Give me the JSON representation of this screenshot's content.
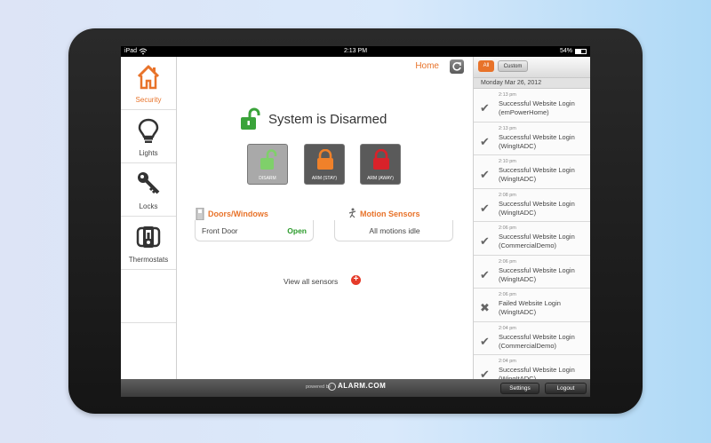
{
  "statusbar": {
    "carrier": "iPad",
    "time": "2:13 PM",
    "battery": "54%"
  },
  "nav": {
    "items": [
      {
        "label": "Security",
        "icon": "home-icon",
        "active": true
      },
      {
        "label": "Lights",
        "icon": "lightbulb-icon"
      },
      {
        "label": "Locks",
        "icon": "key-icon"
      },
      {
        "label": "Thermostats",
        "icon": "thermostat-icon"
      }
    ]
  },
  "main": {
    "home_link": "Home",
    "system_status": "System is Disarmed",
    "arm_buttons": [
      {
        "label": "DISARM",
        "color": "#a9a9a9",
        "icon_color": "#7fd06a"
      },
      {
        "label": "ARM (STAY)",
        "color": "#5a5a5a",
        "icon_color": "#f0812a"
      },
      {
        "label": "ARM (AWAY)",
        "color": "#5a5a5a",
        "icon_color": "#d9222a"
      }
    ],
    "doors": {
      "title": "Doors/Windows",
      "item": "Front Door",
      "state": "Open"
    },
    "motion": {
      "title": "Motion Sensors",
      "state": "All motions idle"
    },
    "view_all": "View all sensors"
  },
  "panel": {
    "tabs": {
      "all": "All",
      "custom": "Custom"
    },
    "date": "Monday Mar 26, 2012",
    "events": [
      {
        "time": "2:13 pm",
        "title": "Successful Website Login",
        "user": "(emPowerHome)",
        "ok": true
      },
      {
        "time": "2:13 pm",
        "title": "Successful Website Login",
        "user": "(WingItADC)",
        "ok": true
      },
      {
        "time": "2:10 pm",
        "title": "Successful Website Login",
        "user": "(WingItADC)",
        "ok": true
      },
      {
        "time": "2:08 pm",
        "title": "Successful Website Login",
        "user": "(WingItADC)",
        "ok": true
      },
      {
        "time": "2:06 pm",
        "title": "Successful Website Login",
        "user": "(CommercialDemo)",
        "ok": true
      },
      {
        "time": "2:06 pm",
        "title": "Successful Website Login",
        "user": "(WingItADC)",
        "ok": true
      },
      {
        "time": "2:06 pm",
        "title": "Failed Website Login",
        "user": "(WingItADC)",
        "ok": false
      },
      {
        "time": "2:04 pm",
        "title": "Successful Website Login",
        "user": "(CommercialDemo)",
        "ok": true
      },
      {
        "time": "2:04 pm",
        "title": "Successful Website Login",
        "user": "(WingItADC)",
        "ok": true
      }
    ]
  },
  "footer": {
    "powered": "powered by",
    "brand": "ALARM.COM",
    "settings": "Settings",
    "logout": "Logout"
  },
  "colors": {
    "accent": "#e8732a",
    "ok": "#2a9a2a",
    "lock_green": "#3aa33a"
  }
}
